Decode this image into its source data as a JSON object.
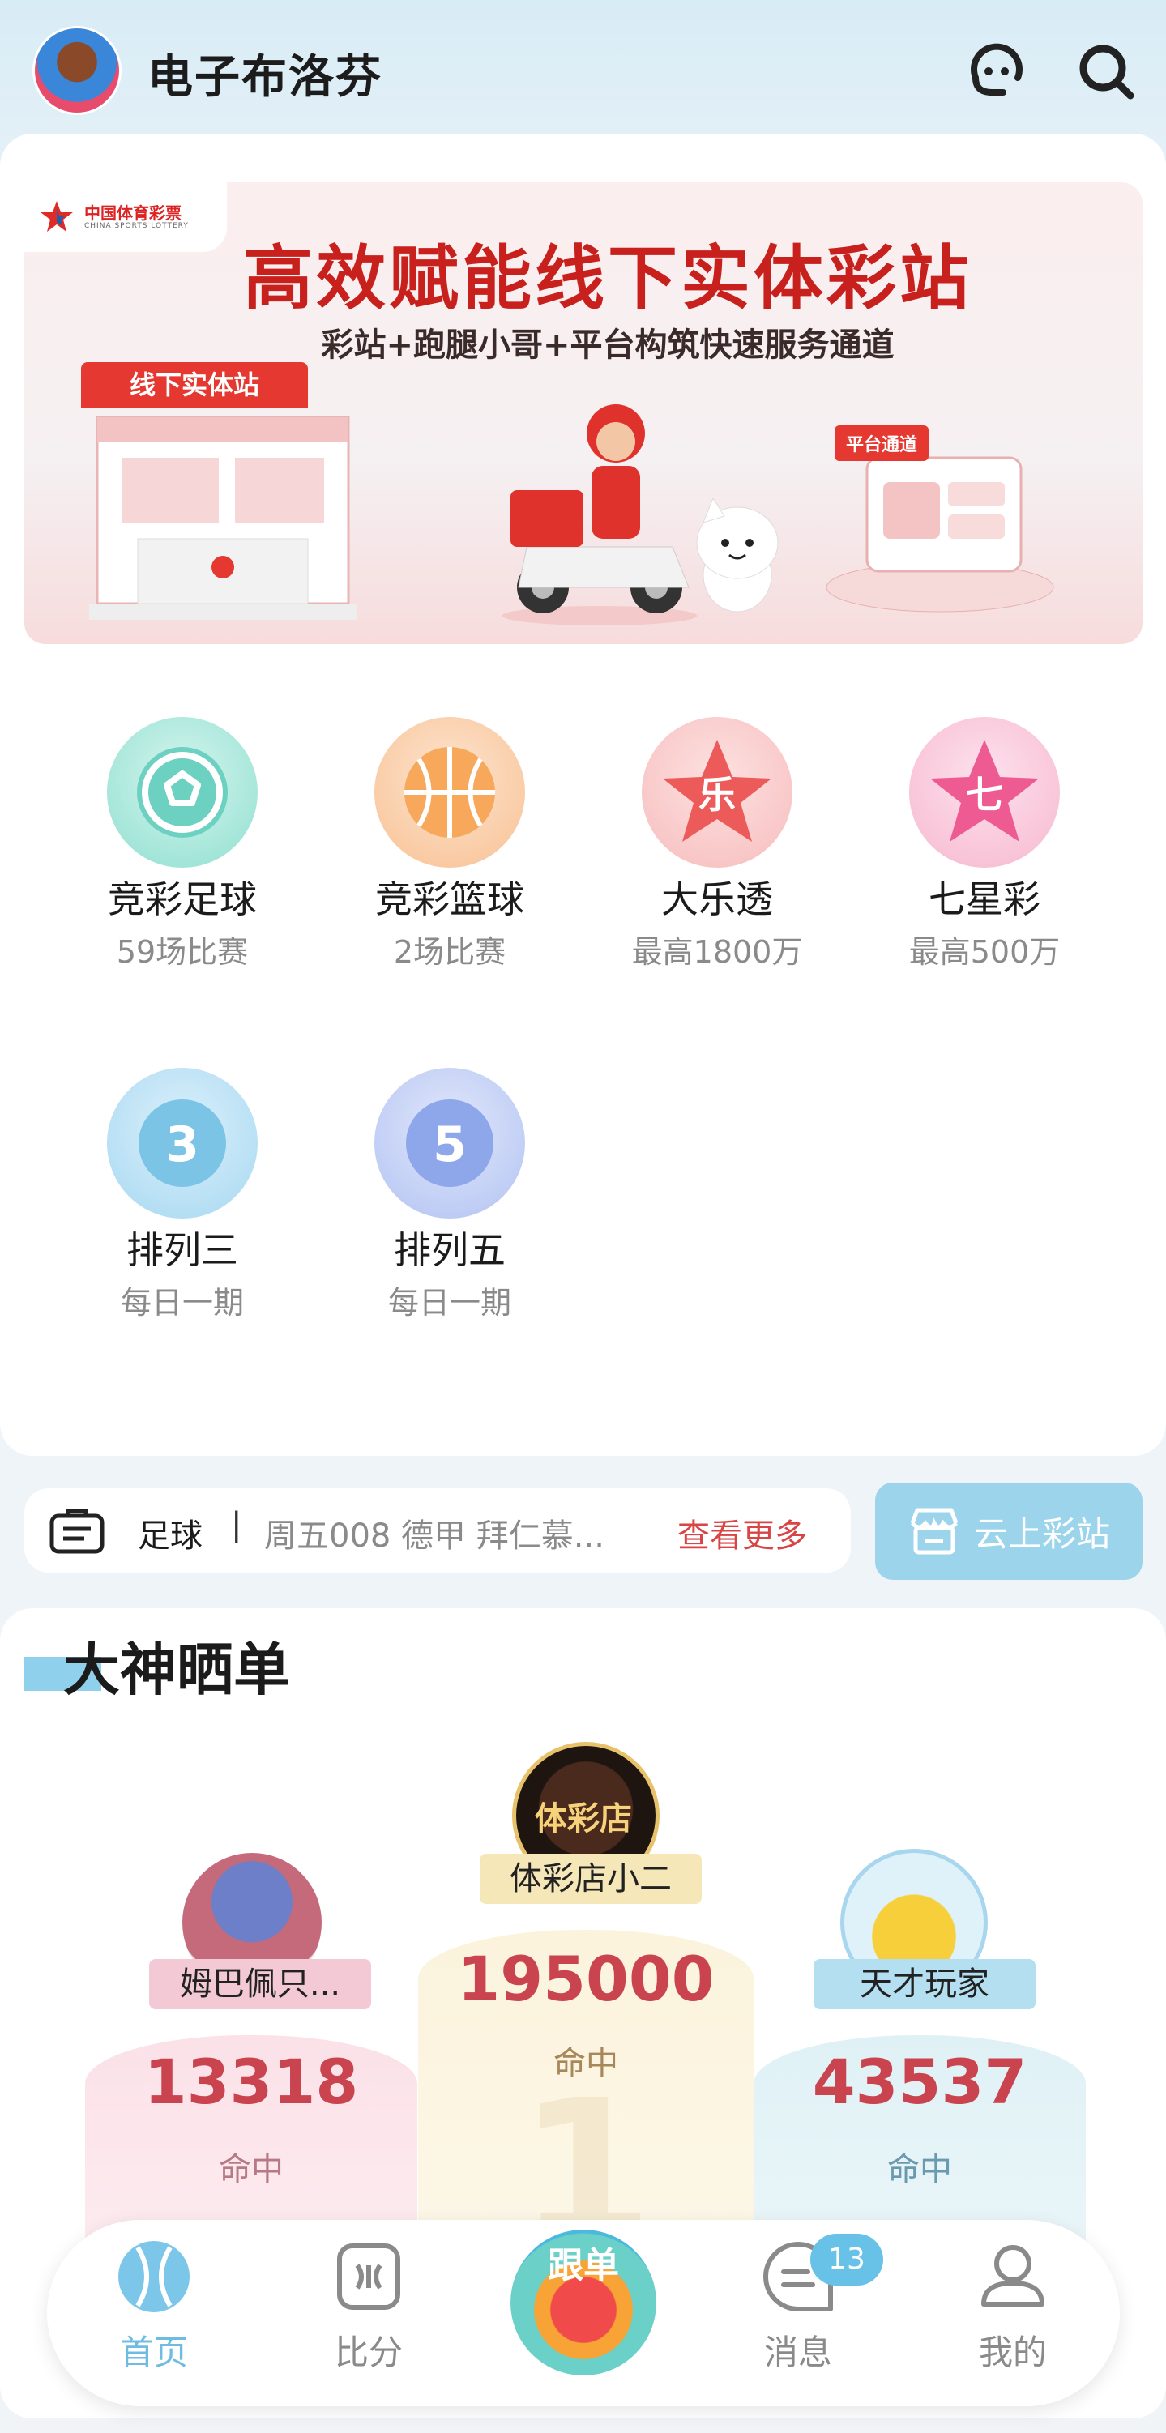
{
  "header": {
    "title": "电子布洛芬",
    "icons": [
      "avatar",
      "bot-icon",
      "search-icon"
    ]
  },
  "banner": {
    "logo_text": "中国体育彩票",
    "logo_sub": "CHINA SPORTS LOTTERY",
    "title": "高效赋能线下实体彩站",
    "subtitle": "彩站+跑腿小哥+平台构筑快速服务通道",
    "shop_sign": "线下实体站",
    "platform_label": "平台通道"
  },
  "games": [
    {
      "name": "竞彩足球",
      "meta": "59场比赛",
      "icon": "football-icon",
      "color": "#7ed9c9"
    },
    {
      "name": "竞彩篮球",
      "meta": "2场比赛",
      "icon": "basketball-icon",
      "color": "#f6b26b"
    },
    {
      "name": "大乐透",
      "meta": "最高1800万",
      "icon": "star-le-icon",
      "color": "#ef6a6a"
    },
    {
      "name": "七星彩",
      "meta": "最高500万",
      "icon": "star-seven-icon",
      "color": "#f06a9a"
    },
    {
      "name": "排列三",
      "meta": "每日一期",
      "icon": "pl3-icon",
      "color": "#7cc4e6"
    },
    {
      "name": "排列五",
      "meta": "每日一期",
      "icon": "pl5-icon",
      "color": "#8ea6ea"
    }
  ],
  "notice": {
    "sport": "足球",
    "separator": "|",
    "text": "周五008 德甲 拜仁慕...",
    "more": "查看更多"
  },
  "cloud_button": {
    "label": "云上彩站"
  },
  "ranking": {
    "title": "大神晒单",
    "first": {
      "name": "体彩店小二",
      "value": "195000",
      "label": "命中",
      "avatar_text": "体彩店"
    },
    "second": {
      "name": "姆巴佩只...",
      "value": "13318",
      "label": "命中"
    },
    "third": {
      "name": "天才玩家",
      "value": "43537",
      "label": "命中"
    }
  },
  "tabbar": {
    "home": "首页",
    "score": "比分",
    "follow": "跟单",
    "messages": "消息",
    "messages_badge": "13",
    "mine": "我的"
  },
  "colors": {
    "accent": "#6fbbe2",
    "brand_red": "#c8201c",
    "rank_number": "#c9444e"
  }
}
